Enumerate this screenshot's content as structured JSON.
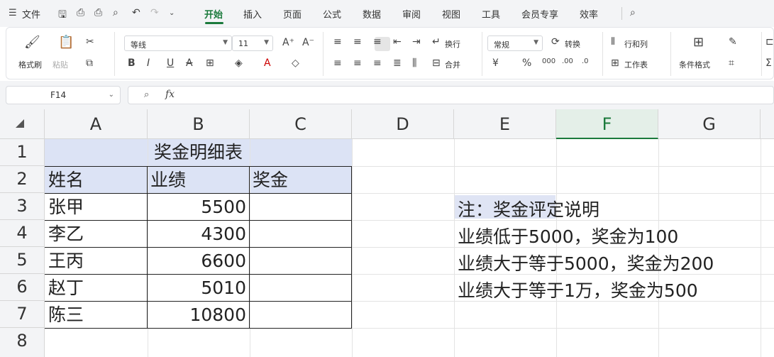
{
  "menubar": {
    "file_label": "文件",
    "tabs": [
      "开始",
      "插入",
      "页面",
      "公式",
      "数据",
      "审阅",
      "视图",
      "工具",
      "会员专享",
      "效率"
    ]
  },
  "ribbon": {
    "format_painter": "格式刷",
    "paste": "粘贴",
    "font_name": "等线",
    "font_size": "11",
    "wrap": "换行",
    "merge": "合并",
    "number_format": "常规",
    "convert": "转换",
    "rows_cols": "行和列",
    "worksheet": "工作表",
    "cond_format": "条件格式"
  },
  "formula_bar": {
    "cell_ref": "F14",
    "fx": "fx",
    "content": ""
  },
  "sheet": {
    "columns": [
      "A",
      "B",
      "C",
      "D",
      "E",
      "F",
      "G"
    ],
    "selected_column": "F",
    "rows": [
      "1",
      "2",
      "3",
      "4",
      "5",
      "6",
      "7",
      "8"
    ],
    "title": "奖金明细表",
    "headers": [
      "姓名",
      "业绩",
      "奖金"
    ],
    "records": [
      {
        "name": "张甲",
        "score": "5500",
        "bonus": ""
      },
      {
        "name": "李乙",
        "score": "4300",
        "bonus": ""
      },
      {
        "name": "王丙",
        "score": "6600",
        "bonus": ""
      },
      {
        "name": "赵丁",
        "score": "5010",
        "bonus": ""
      },
      {
        "name": "陈三",
        "score": "10800",
        "bonus": ""
      }
    ],
    "notes": [
      "注：奖金评定说明",
      "业绩低于5000，奖金为100",
      "业绩大于等于5000，奖金为200",
      "业绩大于等于1万，奖金为500"
    ]
  },
  "colors": {
    "accent": "#1b7a3c",
    "header_fill": "#dce3f5"
  }
}
